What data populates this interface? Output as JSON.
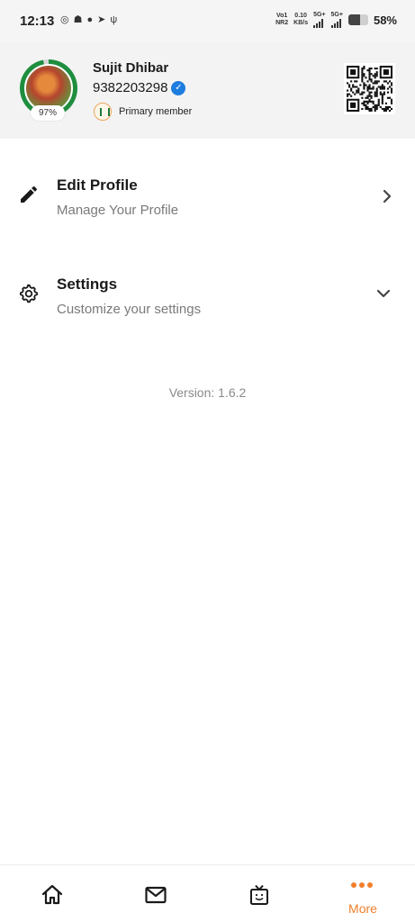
{
  "status_bar": {
    "time": "12:13",
    "left_icons": [
      "instagram-icon",
      "snapchat-icon",
      "chat-icon",
      "telegram-icon",
      "usb-icon"
    ],
    "volte": "Vo1",
    "nr": "NR2",
    "speed_value": "0.10",
    "speed_unit": "KB/s",
    "network1": "5G+",
    "network2": "5G+",
    "battery_percent": "58%",
    "battery_level": 0.58
  },
  "profile": {
    "name": "Sujit Dhibar",
    "phone": "9382203298",
    "completion": "97%",
    "completion_value": 0.97,
    "member_type": "Primary member",
    "ring_color": "#1e8e3e",
    "verified_color": "#1d7ddf"
  },
  "menu": {
    "edit_profile": {
      "title": "Edit Profile",
      "subtitle": "Manage Your Profile",
      "icon": "pencil-icon",
      "chevron": "chevron-right-icon"
    },
    "settings": {
      "title": "Settings",
      "subtitle": "Customize your settings",
      "icon": "gear-icon",
      "chevron": "chevron-down-icon"
    }
  },
  "version_text": "Version: 1.6.2",
  "bottom_nav": {
    "items": [
      {
        "icon": "home-icon",
        "label": ""
      },
      {
        "icon": "mail-icon",
        "label": ""
      },
      {
        "icon": "news-icon",
        "label": ""
      },
      {
        "icon": "more-dots-icon",
        "label": "More",
        "active": true
      }
    ],
    "accent_color": "#f07f2b"
  }
}
